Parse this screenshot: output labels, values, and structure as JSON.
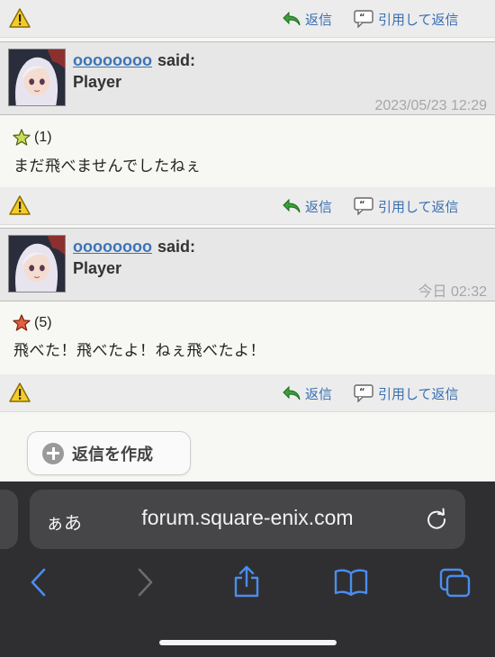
{
  "post_actions": {
    "reply_label": "返信",
    "quote_label": "引用して返信"
  },
  "posts": [
    {
      "username": "oooooooo",
      "said": "said:",
      "title": "Player",
      "date": "2023/05/23 12:29",
      "rating": "(1)",
      "message": "まだ飛べませんでしたねぇ"
    },
    {
      "username": "oooooooo",
      "said": "said:",
      "title": "Player",
      "date": "今日 02:32",
      "rating": "(5)",
      "message": "飛べた！飛べたよ！ねぇ飛べたよ！"
    }
  ],
  "create_reply_label": "返信を作成",
  "browser": {
    "aa_label": "ぁあ",
    "url": "forum.square-enix.com"
  },
  "colors": {
    "link": "#3e73b5",
    "bar": "#ececec",
    "browser_bg": "#2f2f31",
    "accent": "#4a8df0"
  },
  "icons": [
    "warning-icon",
    "reply-arrow-icon",
    "quote-icon",
    "star-icon",
    "plus-icon",
    "reload-icon",
    "back-icon",
    "forward-icon",
    "share-icon",
    "bookmarks-icon",
    "tabs-icon"
  ]
}
